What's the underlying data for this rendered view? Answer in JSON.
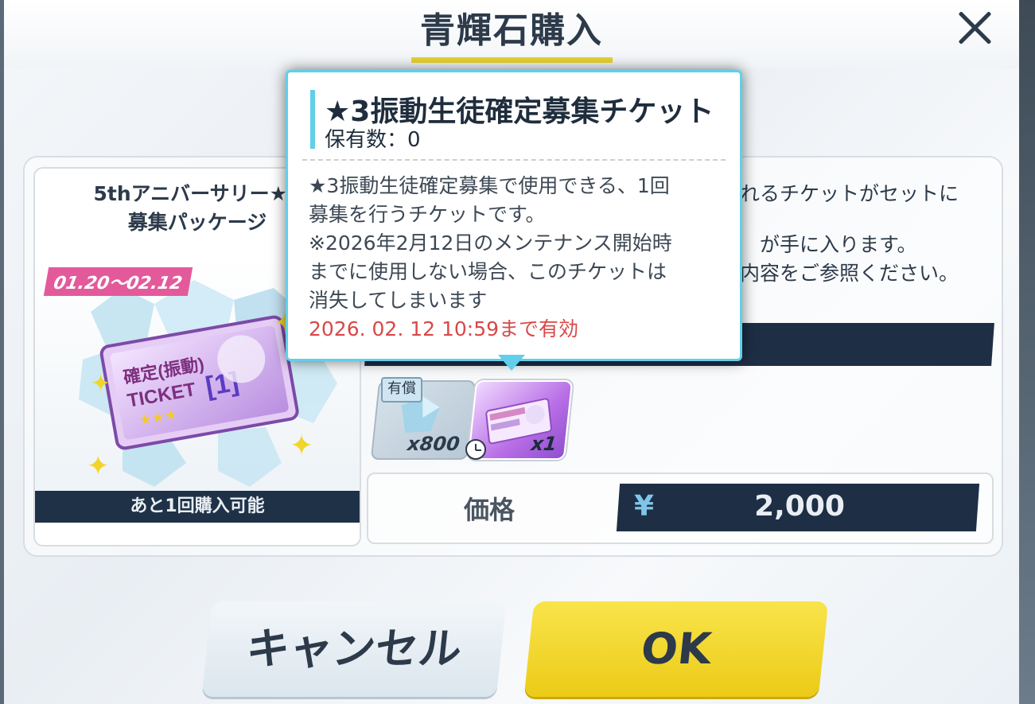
{
  "dialog": {
    "title": "青輝石購入",
    "close_icon": "close-icon"
  },
  "package": {
    "title_line1": "5thアニバーサリー★3",
    "title_line2": "募集パッケージ",
    "date_range": "01.20～02.12",
    "remaining": "あと1回購入可能"
  },
  "description": {
    "line1": "れるチケットがセットに",
    "line2": "が手に入ります。",
    "line3": "内容をご参照ください。"
  },
  "items": [
    {
      "badge": "有償",
      "quantity": "x800",
      "icon": "blue-gem-icon"
    },
    {
      "quantity": "x1",
      "icon": "recruit-ticket-icon",
      "timer_icon": "clock-icon"
    }
  ],
  "price": {
    "label": "価格",
    "currency": "¥",
    "value": "2,000"
  },
  "buttons": {
    "cancel": "キャンセル",
    "ok": "OK"
  },
  "tooltip": {
    "item_name": "★3振動生徒確定募集チケット",
    "owned": "保有数：0",
    "desc_lines": [
      "★3振動生徒確定募集で使用できる、1回",
      "募集を行うチケットです。",
      "※2026年2月12日のメンテナンス開始時",
      "までに使用しない場合、このチケットは",
      "消失してしまいます"
    ],
    "expiry": "2026. 02. 12 10:59まで有効"
  },
  "colors": {
    "accent_cyan": "#61cfe9",
    "navy": "#1e2e44",
    "ok_yellow": "#f2d42a",
    "date_pink": "#e35a9b",
    "expiry_red": "#d84848"
  }
}
